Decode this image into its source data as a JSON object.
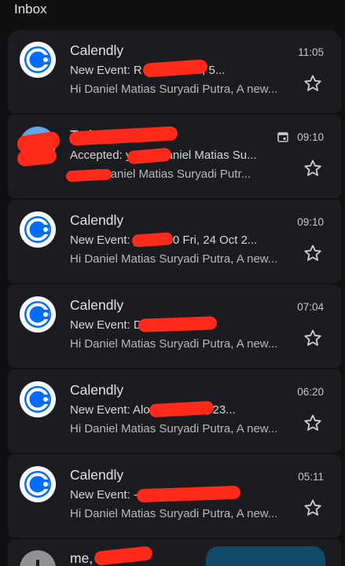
{
  "header": {
    "title": "Inbox"
  },
  "emails": [
    {
      "sender": "Calendly",
      "subject": "New Event: R 13:00 Wed, 5...",
      "snippet": "Hi Daniel Matias Suryadi Putra, A new...",
      "time": "11:05",
      "avatar_icon": "calendly-logo-icon"
    },
    {
      "sender": "Today Gyabaan",
      "subject": "Accepted: y and Daniel Matias Su...",
      "snippet": "y and Daniel Matias Suryadi Putr...",
      "time": "09:10",
      "avatar_icon": "contact-avatar-icon",
      "has_calendar_icon": true
    },
    {
      "sender": "Calendly",
      "subject": "New Event: y - 10:30 Fri, 24 Oct 2...",
      "snippet": "Hi Daniel Matias Suryadi Putra, A new...",
      "time": "09:10",
      "avatar_icon": "calendly-logo-icon"
    },
    {
      "sender": "Calendly",
      "subject": "New Event: D - 14:00 Fri,...",
      "snippet": "Hi Daniel Matias Suryadi Putra, A new...",
      "time": "07:04",
      "avatar_icon": "calendly-logo-icon"
    },
    {
      "sender": "Calendly",
      "subject": "New Event: Alo 15:30 Thu, 23...",
      "snippet": "Hi Daniel Matias Suryadi Putra, A new...",
      "time": "06:20",
      "avatar_icon": "calendly-logo-icon"
    },
    {
      "sender": "Calendly",
      "subject": "New Event: - 16:30...",
      "snippet": "Hi Daniel Matias Suryadi Putra, A new...",
      "time": "05:11",
      "avatar_icon": "calendly-logo-icon"
    }
  ],
  "partial_email": {
    "sender": "me, 5"
  },
  "colors": {
    "background": "#0f1012",
    "card": "#1b1c1f",
    "redaction": "#ff2a1a",
    "calendly_blue": "#006bff",
    "fab": "#0f4a68"
  }
}
